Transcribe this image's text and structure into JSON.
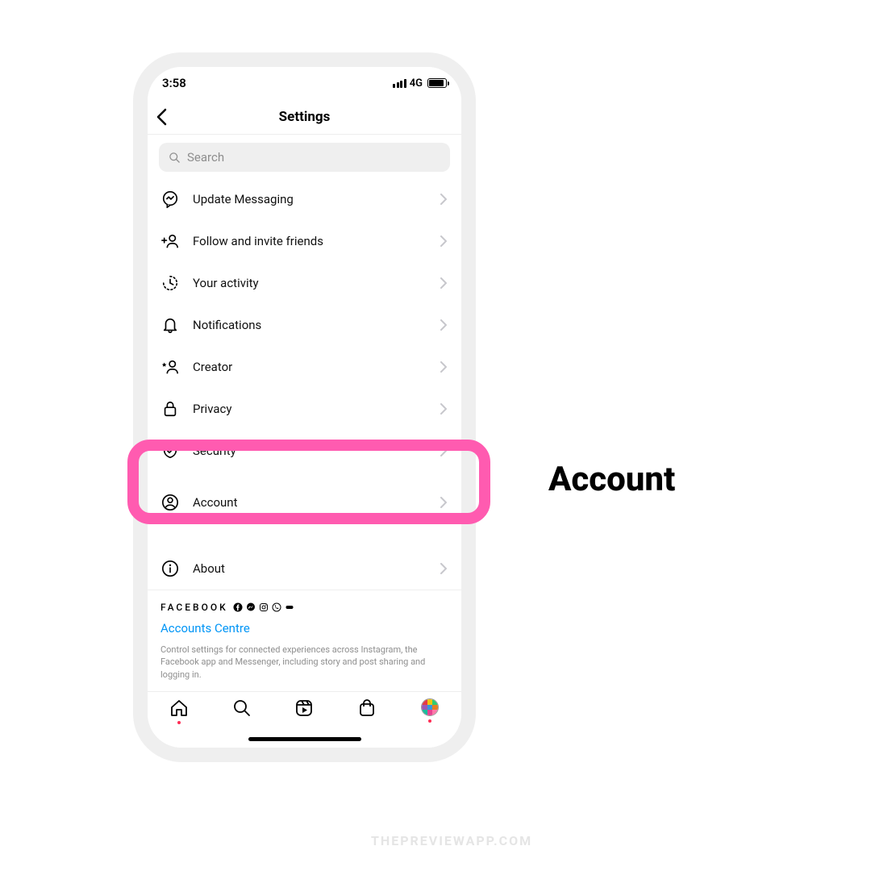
{
  "status": {
    "time": "3:58",
    "network": "4G"
  },
  "header": {
    "title": "Settings"
  },
  "search": {
    "placeholder": "Search"
  },
  "items": [
    {
      "icon": "messenger",
      "label": "Update Messaging"
    },
    {
      "icon": "follow",
      "label": "Follow and invite friends"
    },
    {
      "icon": "activity",
      "label": "Your activity"
    },
    {
      "icon": "bell",
      "label": "Notifications"
    },
    {
      "icon": "creator",
      "label": "Creator"
    },
    {
      "icon": "lock",
      "label": "Privacy"
    },
    {
      "icon": "shield",
      "label": "Security"
    },
    {
      "icon": "account",
      "label": "Account"
    },
    {
      "icon": "info",
      "label": "About"
    }
  ],
  "facebook": {
    "brand": "FACEBOOK",
    "link": "Accounts Centre",
    "desc": "Control settings for connected experiences across Instagram, the Facebook app and Messenger, including story and post sharing and logging in."
  },
  "callout": "Account",
  "watermark": "THEPREVIEWAPP.COM"
}
